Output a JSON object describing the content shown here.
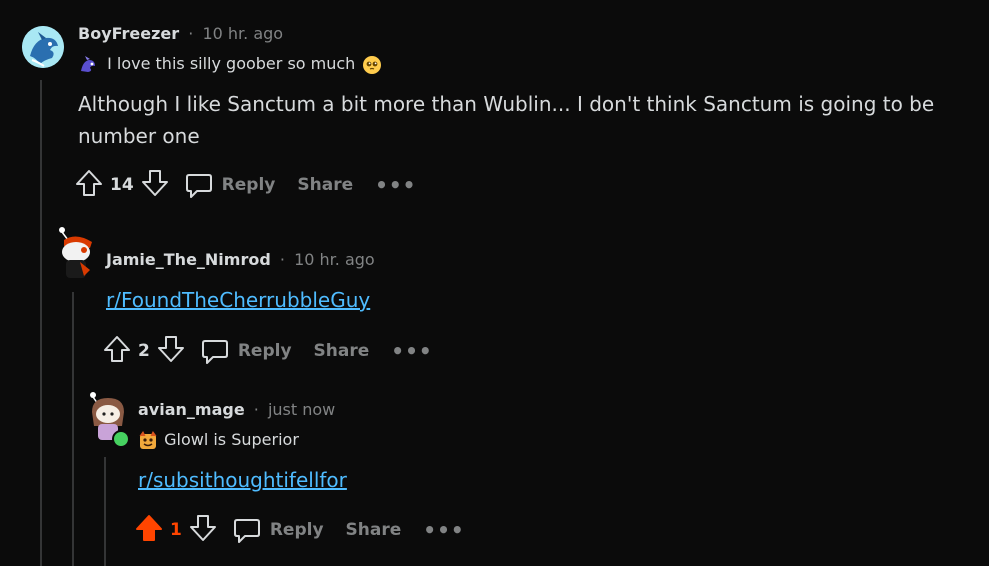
{
  "colors": {
    "background": "#0b0b0b",
    "text": "#d7dadc",
    "muted": "#818384",
    "link": "#4fbcff",
    "upvote_active": "#ff4500",
    "thread_line": "#343536",
    "online": "#46d160"
  },
  "comments": [
    {
      "username": "BoyFreezer",
      "separator": "·",
      "time": "10 hr. ago",
      "flair_icon": "dragon-flair-icon",
      "flair_text": "I love this silly goober so much",
      "flair_emoji": "pleading-face-emoji",
      "body": "Although I like Sanctum a bit more than Wublin... I don't think Sanctum is going to be number one",
      "score": "14",
      "reply_label": "Reply",
      "share_label": "Share",
      "more_label": "•••"
    },
    {
      "username": "Jamie_The_Nimrod",
      "separator": "·",
      "time": "10 hr. ago",
      "link": "r/FoundTheCherrubbleGuy",
      "score": "2",
      "reply_label": "Reply",
      "share_label": "Share",
      "more_label": "•••"
    },
    {
      "username": "avian_mage",
      "separator": "·",
      "time": "just now",
      "flair_icon": "monster-flair-icon",
      "flair_text": "Glowl is Superior",
      "link": "r/subsithoughtifellfor",
      "score": "1",
      "upvoted": true,
      "reply_label": "Reply",
      "share_label": "Share",
      "more_label": "•••"
    }
  ]
}
